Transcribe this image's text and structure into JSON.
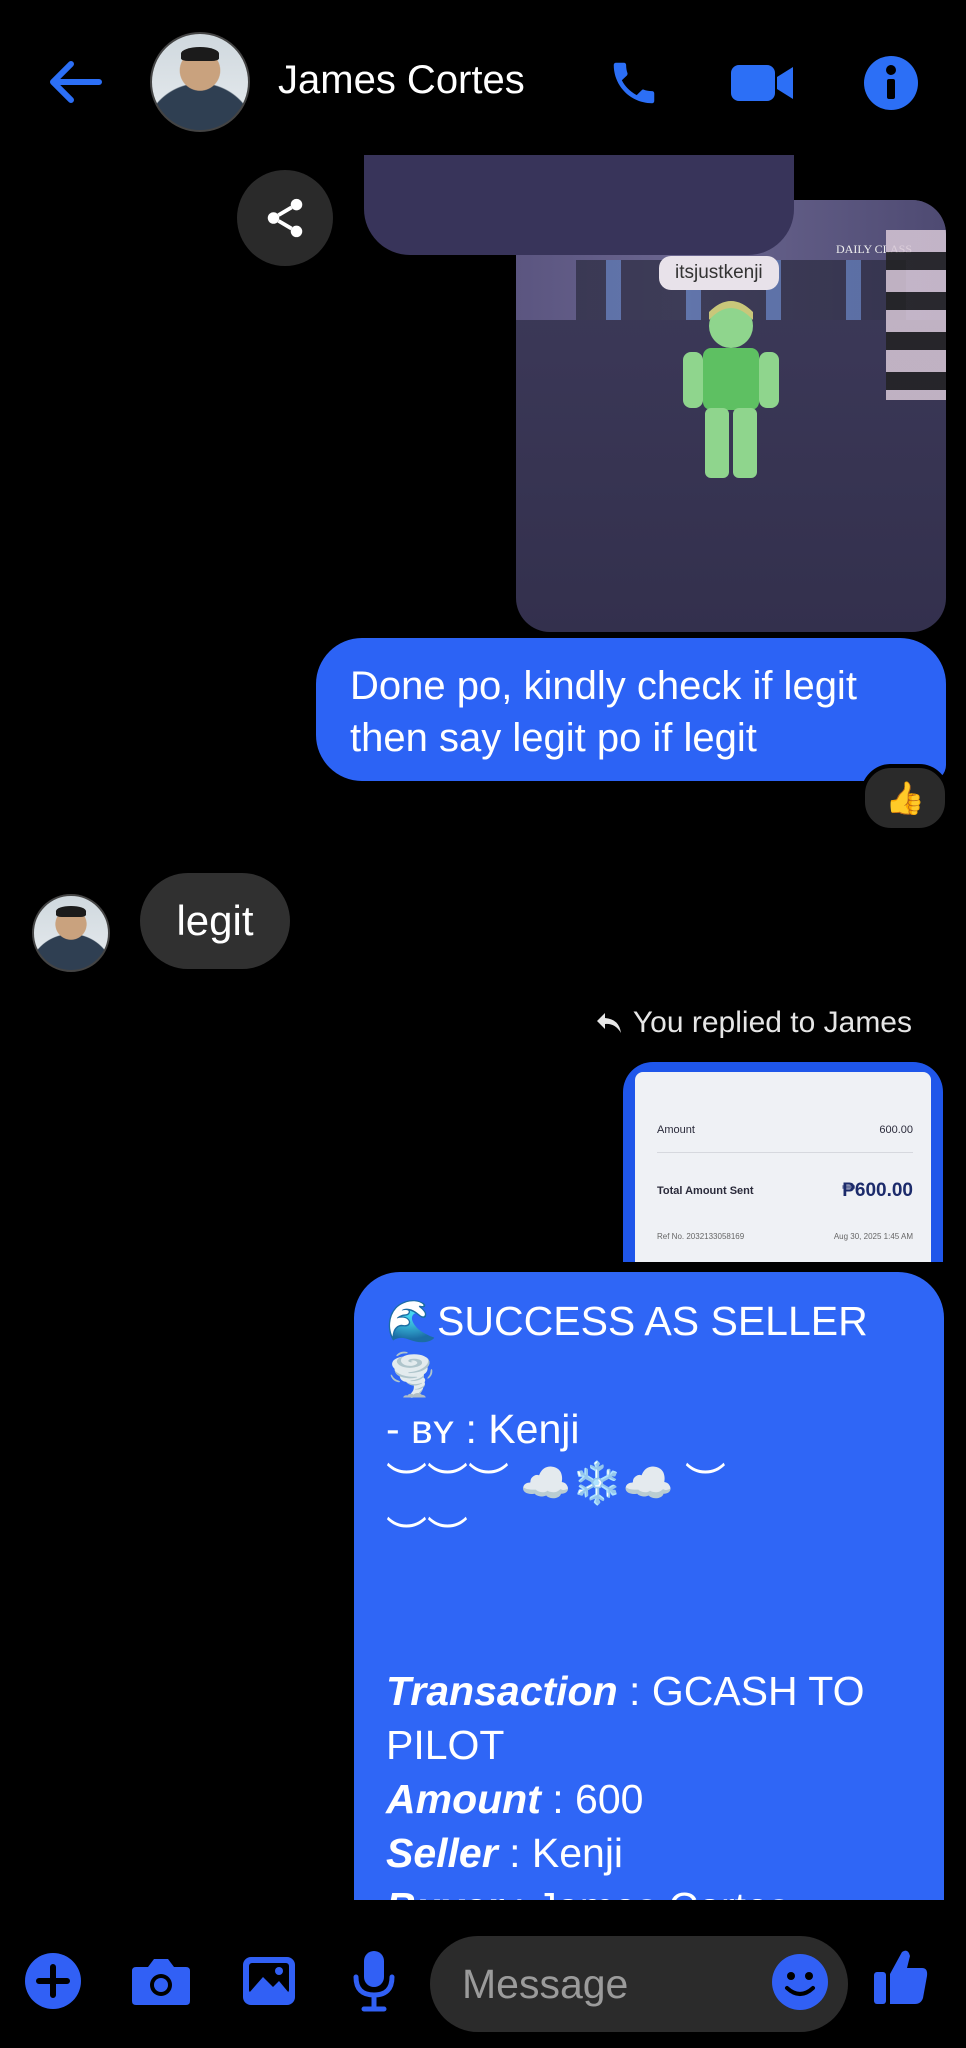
{
  "header": {
    "contact_name": "James Cortes"
  },
  "attachment": {
    "player_tag": "itsjustkenji",
    "sign_text": "DAILY CLASS"
  },
  "messages": {
    "outgoing_1": "Done po, kindly check if legit then say legit po if legit",
    "reaction": "👍",
    "incoming_1": "legit",
    "reply_notice": "You replied to James"
  },
  "receipt": {
    "amount_label": "Amount",
    "amount_value": "600.00",
    "total_label": "Total Amount Sent",
    "total_value": "₱600.00",
    "ref_label": "Ref No. 2032133058169",
    "date_value": "Aug 30, 2025 1:45 AM"
  },
  "success_message": {
    "line1": "🌊SUCCESS AS SELLER🌪️",
    "line2": "- ʙʏ : Kenji",
    "line3": "︶︶︶ ☁️❄️☁️ ︶",
    "line4": "︶︶",
    "transaction_label": "Transaction",
    "transaction_value": " : GCASH TO PILOT",
    "amount_label": "Amount",
    "amount_value": " : 600",
    "seller_label": "Seller",
    "seller_value": " : Kenji",
    "buyer_label": "Buyer",
    "buyer_value": " : James Cortes"
  },
  "composer": {
    "placeholder": "Message"
  },
  "colors": {
    "accent": "#2c63f5",
    "background": "#000000",
    "incoming_bubble": "#303030"
  }
}
